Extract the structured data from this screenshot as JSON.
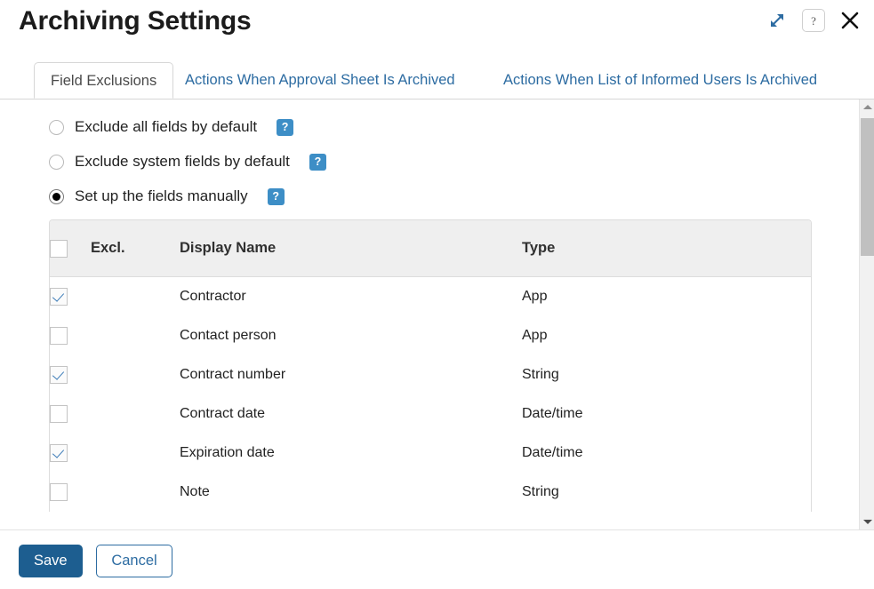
{
  "header": {
    "title": "Archiving Settings",
    "actions": [
      {
        "name": "expand-icon",
        "label": "Expand"
      },
      {
        "name": "help-icon",
        "label": "?"
      },
      {
        "name": "close-icon",
        "label": "Close"
      }
    ],
    "help_glyph": "?"
  },
  "tabs": [
    {
      "label": "Field Exclusions",
      "active": true
    },
    {
      "label": "Actions When Approval Sheet Is Archived",
      "active": false
    },
    {
      "label": "Actions When List of Informed Users Is Archived",
      "active": false
    }
  ],
  "options": [
    {
      "label": "Exclude all fields by default",
      "selected": false,
      "help": "?"
    },
    {
      "label": "Exclude system fields by default",
      "selected": false,
      "help": "?"
    },
    {
      "label": "Set up the fields manually",
      "selected": true,
      "help": "?"
    }
  ],
  "table": {
    "headers": {
      "select_all": "",
      "excl": "Excl.",
      "display_name": "Display Name",
      "type": "Type"
    },
    "select_all_checked": false,
    "rows": [
      {
        "checked": true,
        "display_name": "Contractor",
        "type": "App"
      },
      {
        "checked": false,
        "display_name": "Contact person",
        "type": "App"
      },
      {
        "checked": true,
        "display_name": "Contract number",
        "type": "String"
      },
      {
        "checked": false,
        "display_name": "Contract date",
        "type": "Date/time"
      },
      {
        "checked": true,
        "display_name": "Expiration date",
        "type": "Date/time"
      },
      {
        "checked": false,
        "display_name": "Note",
        "type": "String"
      }
    ]
  },
  "footer": {
    "save_label": "Save",
    "cancel_label": "Cancel"
  },
  "colors": {
    "accent_blue": "#2d6ca2",
    "save_blue": "#1d5e90",
    "badge_blue": "#3d8ec6",
    "header_gray": "#efefef",
    "border_gray": "#dddddd",
    "scrollbar_thumb": "#c0c0c0"
  },
  "scrollbar": {
    "up_arrow": "▲",
    "down_arrow": "▼"
  }
}
